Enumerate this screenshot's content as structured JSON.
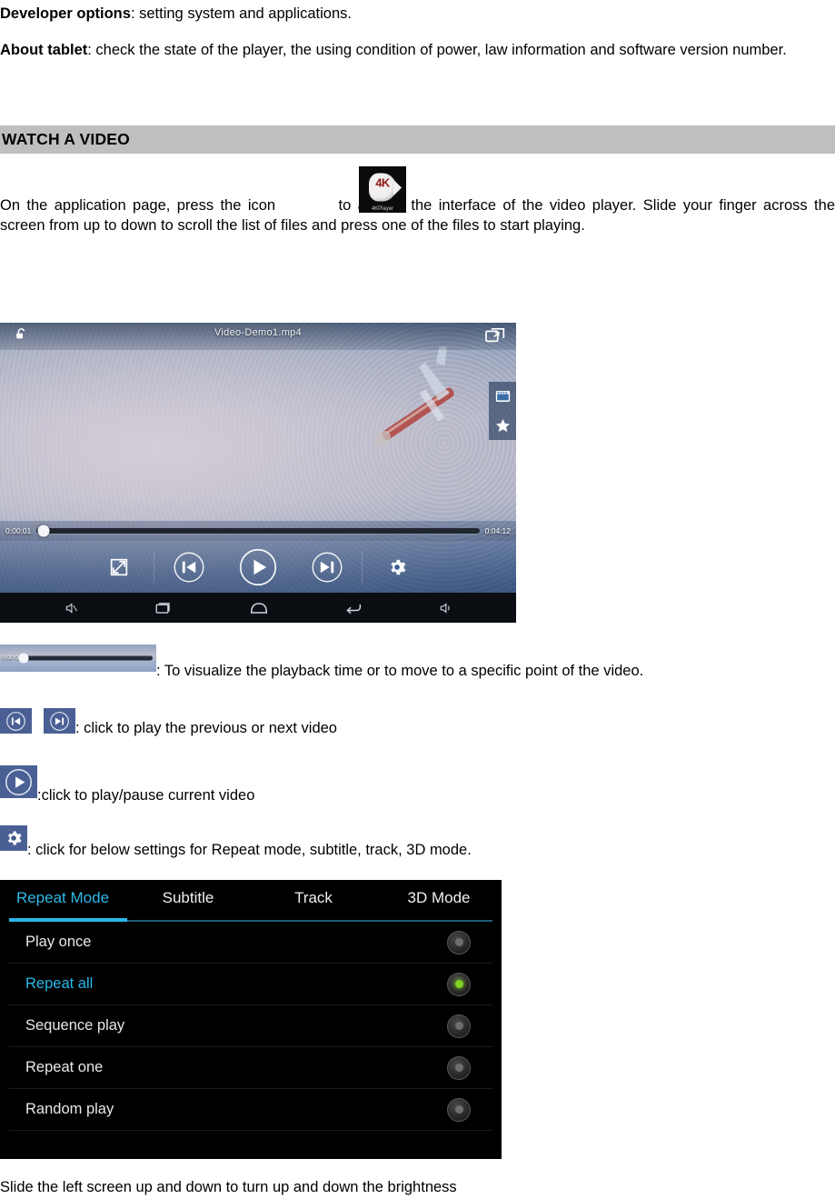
{
  "document": {
    "paragraphs": {
      "developer_options_bold": "Developer options",
      "developer_options_rest": ": setting system and applications.",
      "about_tablet_bold": "About tablet",
      "about_tablet_rest": ": check the state of the player, the using condition of power, law information and software version number."
    },
    "section_heading": "WATCH A VIDEO",
    "intro_before_icon": "On the application page, press the icon",
    "intro_after_icon": "to access the interface of the video player. Slide your finger across the screen from up to down to scroll the list of files and press one of the files to start playing.",
    "closing_line": "Slide the left screen up and down to turn up and down the brightness"
  },
  "app_icon": {
    "label": "4K",
    "caption": "4KPlayer"
  },
  "player": {
    "title": "Video-Demo1.mp4",
    "current_time": "0:00:01",
    "total_time": "0:04:12",
    "icons": {
      "lock": "unlock-icon",
      "pip": "popout-window-icon",
      "snapshot": "screenshot-icon",
      "favorite": "star-icon",
      "aspect": "aspect-ratio-icon",
      "previous": "skip-previous-icon",
      "play": "play-icon",
      "next": "skip-next-icon",
      "settings": "gear-icon"
    },
    "navbar": [
      "mute-icon",
      "recents-icon",
      "home-icon",
      "back-icon",
      "volume-icon"
    ]
  },
  "captions": [
    {
      "icon": "progress-bar-icon",
      "text": ": To visualize the playback time or to move to a specific point of the video."
    },
    {
      "icon": "skip-previous-next-icon",
      "text": ": click to play the previous or next video"
    },
    {
      "icon": "play-pause-icon",
      "text": ":click to play/pause current video"
    },
    {
      "icon": "gear-icon",
      "text": ": click for below settings for Repeat mode, subtitle, track, 3D mode."
    }
  ],
  "settings_panel": {
    "tabs": [
      {
        "label": "Repeat Mode",
        "active": true
      },
      {
        "label": "Subtitle",
        "active": false
      },
      {
        "label": "Track",
        "active": false
      },
      {
        "label": "3D Mode",
        "active": false
      }
    ],
    "options": [
      {
        "label": "Play once",
        "selected": false
      },
      {
        "label": "Repeat all",
        "selected": true
      },
      {
        "label": "Sequence play",
        "selected": false
      },
      {
        "label": "Repeat one",
        "selected": false
      },
      {
        "label": "Random play",
        "selected": false
      }
    ],
    "accent_color": "#29b6e8",
    "selected_dot_color": "#7ed321"
  }
}
